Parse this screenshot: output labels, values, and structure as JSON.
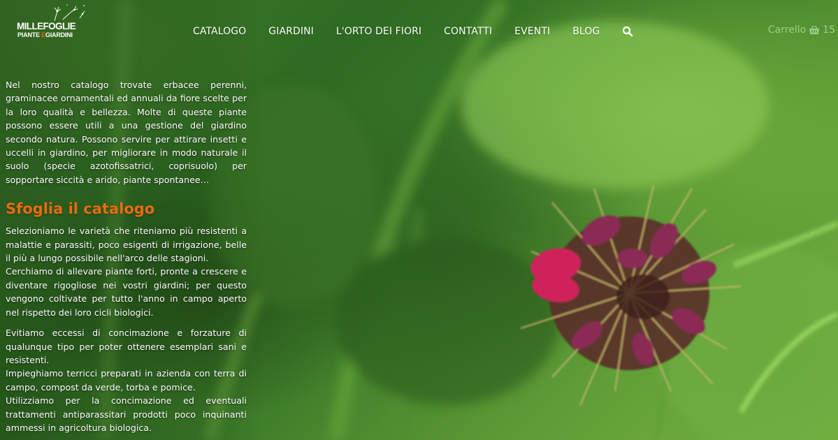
{
  "logo": {
    "line1": "MILLEFOGLIE",
    "line2_a": "PIANTE ",
    "line2_amp": "E",
    "line2_b": "GIARDINI"
  },
  "nav": {
    "items": [
      "CATALOGO",
      "GIARDINI",
      "L'ORTO DEI FIORI",
      "CONTATTI",
      "EVENTI",
      "BLOG"
    ],
    "search_icon": "search-icon"
  },
  "cart": {
    "label": "Carrello",
    "icon": "basket-icon",
    "count": "15"
  },
  "content": {
    "intro": "Nel nostro catalogo trovate erbacee perenni, graminacee ornamentali ed annuali da fiore scelte per la loro qualità e bellezza. Molte di queste piante possono essere utili a una gestione del giardino secondo natura. Possono servire per attirare insetti e uccelli in giardino, per migliorare in modo naturale il suolo (specie azotofissatrici, coprisuolo) per sopportare siccità e arido, piante spontanee…",
    "heading": "Sfoglia il catalogo",
    "p1": "Selezioniamo le varietà che riteniamo più resistenti a malattie e parassiti, poco esigenti di irrigazione, belle il più a lungo possibile nell'arco delle stagioni.",
    "p2": "Cerchiamo di allevare piante forti, pronte a crescere e diventare rigogliose nei vostri giardini; per questo vengono coltivate per tutto l'anno in campo aperto nel rispetto dei loro cicli biologici.",
    "p3": "Evitiamo eccessi di concimazione e forzature di qualunque tipo per poter ottenere esemplari sani e resistenti.",
    "p4": "Impieghiamo terricci preparati in azienda con terra di campo, compost da verde, torba e pomice.",
    "p5": "Utilizziamo per la concimazione ed eventuali trattamenti antiparassitari prodotti poco inquinanti ammessi in agricoltura biologica."
  },
  "colors": {
    "accent": "#ec6a12",
    "cart": "#9ed08a",
    "text": "#ffffff"
  }
}
